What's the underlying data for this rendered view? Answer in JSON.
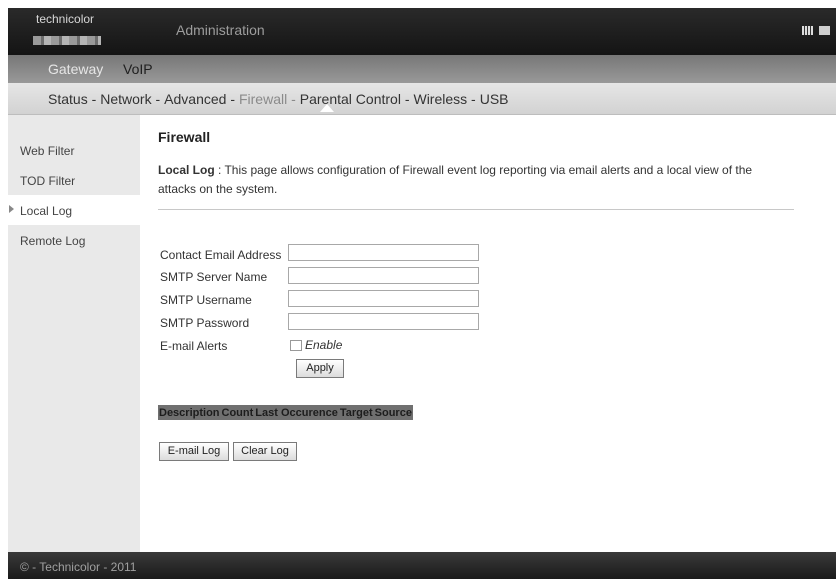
{
  "header": {
    "logo_text": "technicolor",
    "title": "Administration",
    "lang_icons": [
      "flag-icon",
      "flag-icon"
    ]
  },
  "top_tabs": [
    "Gateway",
    "VoIP"
  ],
  "nav": {
    "items": [
      "Status -",
      "Network -",
      "Advanced -",
      "Firewall -",
      "Parental Control -",
      "Wireless -",
      "USB"
    ],
    "selected": "Firewall -"
  },
  "sidebar": {
    "items": [
      "Web Filter",
      "TOD Filter",
      "Local Log",
      "Remote Log"
    ],
    "active": "Local Log"
  },
  "main": {
    "title": "Firewall",
    "desc_label": "Local Log",
    "desc_text": " : This page allows configuration of Firewall event log reporting via email alerts and a local view of the attacks on the system.",
    "fields": {
      "contact_email_label": "Contact Email Address",
      "contact_email_value": "",
      "smtp_server_label": "SMTP Server Name",
      "smtp_server_value": "",
      "smtp_username_label": "SMTP Username",
      "smtp_username_value": "",
      "smtp_password_label": "SMTP Password",
      "smtp_password_value": "",
      "email_alerts_label": "E-mail Alerts",
      "enable_label": "Enable"
    },
    "apply_label": "Apply",
    "table_headers": [
      "Description",
      "Count",
      "Last Occurence",
      "Target",
      "Source"
    ],
    "email_log_label": "E-mail Log",
    "clear_log_label": "Clear Log"
  },
  "footer": {
    "text": "© - Technicolor - 2011"
  },
  "colors": {
    "header_bg": "#1c1c1c",
    "table_header_bg": "#707070",
    "sidebar_bg": "#e9e9e9"
  }
}
